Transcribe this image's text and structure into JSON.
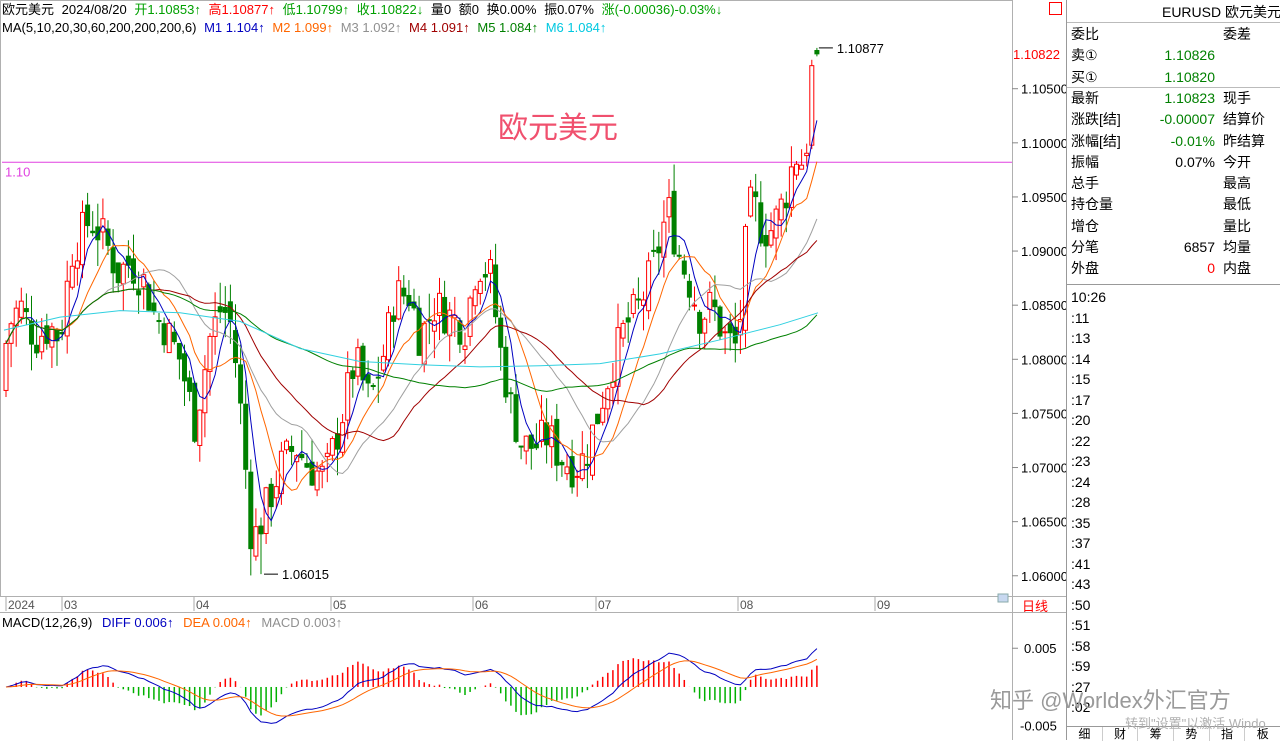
{
  "header": {
    "name": "欧元美元",
    "date": "2024/08/20",
    "open": "开1.10853↑",
    "high": "高1.10877↑",
    "low": "低1.10799↑",
    "close": "收1.10822↓",
    "vol": "量0",
    "amt": "额0",
    "turn": "换0.00%",
    "amp": "振0.07%",
    "chg": "涨(-0.00036)-0.03%↓"
  },
  "ma": {
    "label": "MA(5,10,20,30,60,200,200,200,6)",
    "m1": "M1 1.104↑",
    "m2": "M2 1.099↑",
    "m3": "M3 1.092↑",
    "m4": "M4 1.091↑",
    "m5": "M5 1.084↑",
    "m6": "M6 1.084↑"
  },
  "watermark": "欧元美元",
  "chart": {
    "hline_label": "1.10",
    "hline_value": 1.0982,
    "last_price_label": "1.10822",
    "high_marker": "1.10877",
    "low_marker": "1.06015",
    "price_ticks": [
      "1.10500",
      "1.10000",
      "1.09500",
      "1.09000",
      "1.08500",
      "1.08000",
      "1.07500",
      "1.07000",
      "1.06500",
      "1.06000"
    ],
    "price_tick_values": [
      1.105,
      1.1,
      1.095,
      1.09,
      1.085,
      1.08,
      1.075,
      1.07,
      1.065,
      1.06
    ],
    "x_labels": [
      "2024",
      "03",
      "04",
      "05",
      "06",
      "07",
      "08",
      "09"
    ],
    "period_label": "日线"
  },
  "macd": {
    "label": "MACD(12,26,9)",
    "diff": "DIFF 0.006↑",
    "dea": "DEA 0.004↑",
    "macd": "MACD 0.003↑",
    "ticks": [
      "0.005",
      "-0.005"
    ]
  },
  "panel": {
    "title": "EURUSD 欧元美元",
    "rows": [
      {
        "l": "委比",
        "v": "",
        "r": "委差"
      },
      {
        "l": "卖①",
        "v": "1.10826",
        "r": ""
      },
      {
        "l": "买①",
        "v": "1.10820",
        "r": ""
      },
      {
        "l": "最新",
        "v": "1.10823",
        "r": "现手"
      },
      {
        "l": "涨跌[结]",
        "v": "-0.00007",
        "r": "结算价"
      },
      {
        "l": "涨幅[结]",
        "v": "-0.01%",
        "r": "昨结算"
      },
      {
        "l": "振幅",
        "v": "0.07%",
        "r": "今开"
      },
      {
        "l": "总手",
        "v": "",
        "r": "最高"
      },
      {
        "l": "持仓量",
        "v": "",
        "r": "最低"
      },
      {
        "l": "增仓",
        "v": "",
        "r": "量比"
      },
      {
        "l": "分笔",
        "v": "6857",
        "r": "均量"
      },
      {
        "l": "外盘",
        "v": "0",
        "r": "内盘"
      }
    ],
    "times": [
      "10:26",
      ":11",
      ":13",
      ":14",
      ":15",
      ":17",
      ":20",
      ":22",
      ":23",
      ":24",
      ":28",
      ":35",
      ":37",
      ":41",
      ":43",
      ":50",
      ":51",
      ":58",
      ":59",
      ":27",
      ":02"
    ],
    "tabs": [
      "细",
      "财",
      "筹",
      "势",
      "指",
      "板"
    ]
  },
  "overlay": {
    "brand": "知乎 @Worldex外汇官方",
    "win": "转到\"设置\"以激活 Windo"
  },
  "colors": {
    "up": "#ff0000",
    "down": "#008000",
    "hline": "#e040e0"
  }
}
